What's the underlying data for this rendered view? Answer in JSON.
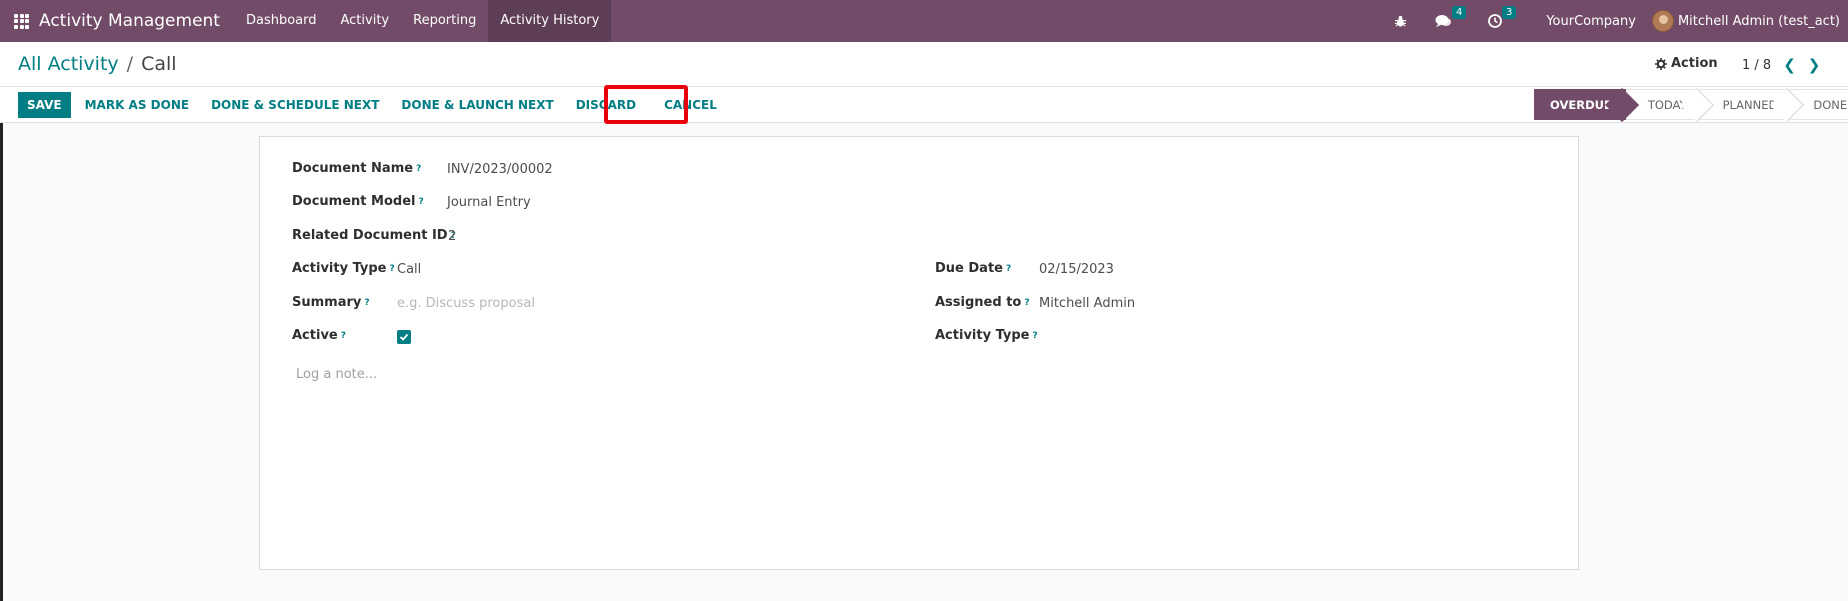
{
  "navbar": {
    "brand": "Activity Management",
    "items": [
      {
        "label": "Dashboard"
      },
      {
        "label": "Activity"
      },
      {
        "label": "Reporting"
      },
      {
        "label": "Activity History"
      }
    ],
    "messages_count": "4",
    "activities_count": "3",
    "company": "YourCompany",
    "user": "Mitchell Admin (test_act)"
  },
  "control_panel": {
    "breadcrumb_parent": "All Activity",
    "breadcrumb_separator": "/",
    "breadcrumb_current": "Call",
    "action_label": "Action",
    "pager": "1 / 8"
  },
  "buttons": {
    "save": "SAVE",
    "mark_done": "MARK AS DONE",
    "done_schedule": "DONE & SCHEDULE NEXT",
    "done_launch": "DONE & LAUNCH NEXT",
    "discard": "DISCARD",
    "cancel": "CANCEL"
  },
  "status_stages": [
    {
      "label": "OVERDUE",
      "current": true
    },
    {
      "label": "TODAY",
      "current": false
    },
    {
      "label": "PLANNED",
      "current": false
    },
    {
      "label": "DONE",
      "current": false
    }
  ],
  "form": {
    "document_name_label": "Document Name",
    "document_name": "INV/2023/00002",
    "document_model_label": "Document Model",
    "document_model": "Journal Entry",
    "related_id_label": "Related Document ID",
    "related_id": "2",
    "activity_type_label": "Activity Type",
    "activity_type": "Call",
    "summary_label": "Summary",
    "summary_placeholder": "e.g. Discuss proposal",
    "active_label": "Active",
    "active_checked": true,
    "due_date_label": "Due Date",
    "due_date": "02/15/2023",
    "assigned_to_label": "Assigned to",
    "assigned_to": "Mitchell Admin",
    "activity_type2_label": "Activity Type",
    "note_placeholder": "Log a note...",
    "help_mark": "?"
  },
  "colors": {
    "brand": "#714b67",
    "accent": "#017e84",
    "highlight": "#e8000b"
  },
  "icons": {
    "apps": "apps-grid-icon",
    "bug": "bug-icon",
    "chat": "chat-icon",
    "clock": "clock-icon",
    "gear": "gear-icon",
    "prev": "chevron-left-icon",
    "next": "chevron-right-icon",
    "check": "checkmark-icon"
  }
}
